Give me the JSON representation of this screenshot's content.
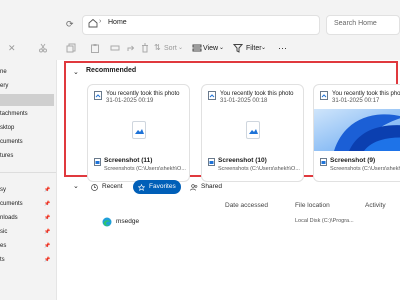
{
  "address": {
    "path": "Home",
    "search_placeholder": "Search Home"
  },
  "toolbar": {
    "sort": "Sort",
    "view": "View",
    "filter": "Filter",
    "more": "···"
  },
  "sidebar": {
    "items": [
      {
        "label": "ne",
        "pinned": false
      },
      {
        "label": "ery",
        "pinned": false
      },
      {
        "label": "",
        "pinned": false,
        "selected": true
      },
      {
        "label": "tachments",
        "pinned": false
      },
      {
        "label": "sktop",
        "pinned": false
      },
      {
        "label": "cuments",
        "pinned": false
      },
      {
        "label": "tures",
        "pinned": false
      },
      {
        "label": "sy",
        "pinned": true
      },
      {
        "label": "cuments",
        "pinned": true
      },
      {
        "label": "nloads",
        "pinned": true
      },
      {
        "label": "sic",
        "pinned": true
      },
      {
        "label": "es",
        "pinned": true
      },
      {
        "label": "ts",
        "pinned": true
      }
    ]
  },
  "recommended": {
    "title": "Recommended",
    "cards": [
      {
        "reason": "You recently took this photo",
        "date": "31-01-2025 00:19",
        "name": "Screenshot (11)",
        "location": "Screenshots (C:\\Users\\shekh\\O...",
        "thumb": "image-placeholder"
      },
      {
        "reason": "You recently took this photo",
        "date": "31-01-2025 00:18",
        "name": "Screenshot (10)",
        "location": "Screenshots (C:\\Users\\shekh\\O...",
        "thumb": "image-placeholder"
      },
      {
        "reason": "You recently took this photo",
        "date": "31-01-2025 00:17",
        "name": "Screenshot (9)",
        "location": "Screenshots (C:\\Users\\shekh\\O...",
        "thumb": "windows-wallpaper"
      }
    ]
  },
  "tabs": [
    {
      "label": "Recent",
      "icon": "clock-icon",
      "active": false
    },
    {
      "label": "Favorites",
      "icon": "star-icon",
      "active": true
    },
    {
      "label": "Shared",
      "icon": "people-icon",
      "active": false
    }
  ],
  "columns": {
    "name": "Name",
    "date": "Date accessed",
    "location": "File location",
    "activity": "Activity"
  },
  "rows": [
    {
      "name": "msedge",
      "date": "",
      "location": "Local Disk (C:)\\Progra...",
      "activity": ""
    }
  ],
  "colors": {
    "accent": "#005fb8",
    "highlight": "#e0393e"
  }
}
